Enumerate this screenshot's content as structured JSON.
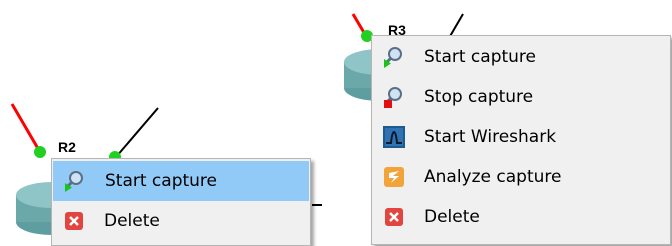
{
  "nodes": [
    {
      "label": "R2"
    },
    {
      "label": "R3"
    }
  ],
  "menu_left": {
    "items": [
      {
        "label": "Start capture",
        "icon": "magnifier-start-icon",
        "highlighted": true
      },
      {
        "label": "Delete",
        "icon": "delete-icon",
        "highlighted": false
      }
    ]
  },
  "menu_right": {
    "items": [
      {
        "label": "Start capture",
        "icon": "magnifier-start-icon"
      },
      {
        "label": "Stop capture",
        "icon": "magnifier-stop-icon"
      },
      {
        "label": "Start Wireshark",
        "icon": "wireshark-icon"
      },
      {
        "label": "Analyze capture",
        "icon": "analyze-icon"
      },
      {
        "label": "Delete",
        "icon": "delete-icon"
      }
    ]
  },
  "colors": {
    "link_red": "#ff0000",
    "link_black": "#000000",
    "port_green": "#22d022",
    "highlight": "#91c9f7",
    "menu_bg": "#f0f0f0"
  }
}
